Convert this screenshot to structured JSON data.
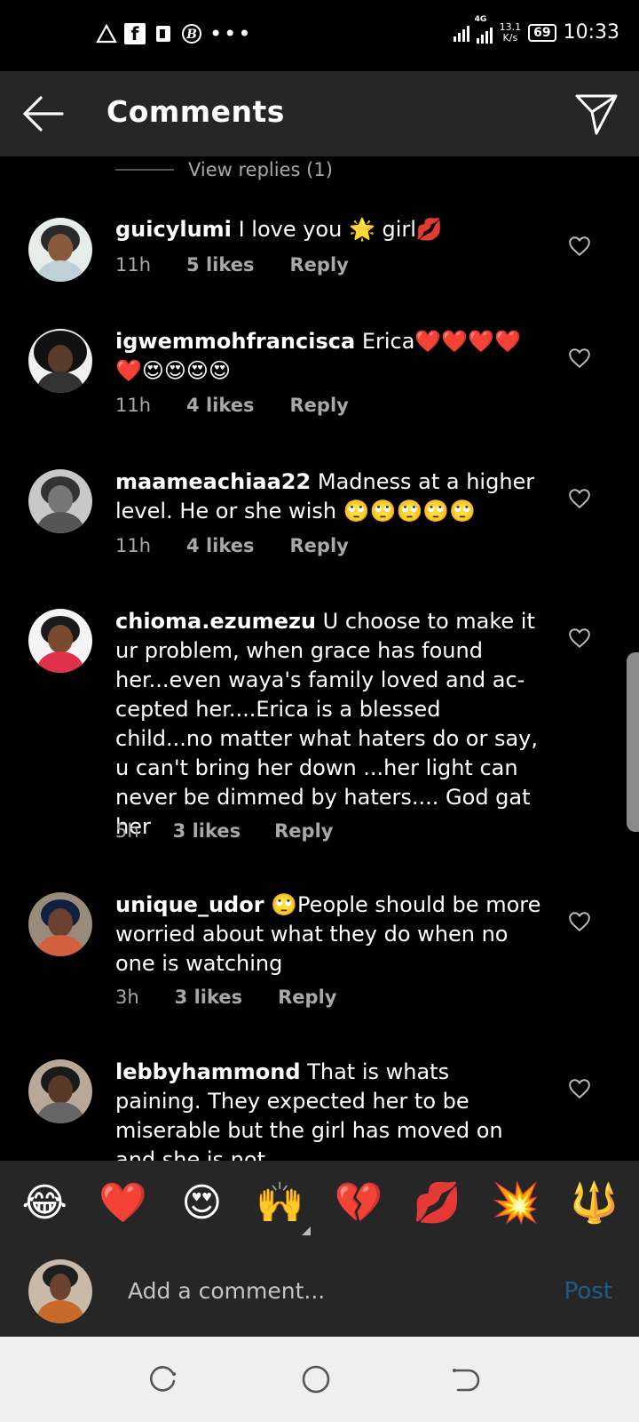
{
  "status_bar": {
    "network": "4G",
    "speed_value": "13.1",
    "speed_unit": "K/s",
    "battery": "69",
    "time": "10:33",
    "notification_dots": "•••"
  },
  "header": {
    "title": "Comments"
  },
  "view_replies": "View replies (1)",
  "comments": [
    {
      "user": "guicylumi",
      "text": "I love you 🌟 girl💋",
      "time": "11h",
      "likes": "5 likes",
      "reply": "Reply"
    },
    {
      "user": "igwemmohfrancisca",
      "text": "Erica❤️❤️❤️❤️❤️😍😍😍😍",
      "time": "11h",
      "likes": "4 likes",
      "reply": "Reply"
    },
    {
      "user": "maameachiaa22",
      "text": "Madness at a higher level. He or she wish 🙄🙄🙄🙄🙄",
      "time": "11h",
      "likes": "4 likes",
      "reply": "Reply"
    },
    {
      "user": "chioma.ezumezu",
      "text": "U choose to make it ur problem, when grace has found her...even waya's family loved and ac- cepted her....Erica is a blessed child...no matter what haters do or say, u can't bring her down ...her light can never be dimmed by haters.... God gat her",
      "time": "5h",
      "likes": "3 likes",
      "reply": "Reply"
    },
    {
      "user": "unique_udor",
      "text": "🙄People should be more worried about what they do when no one is watching",
      "time": "3h",
      "likes": "3 likes",
      "reply": "Reply"
    },
    {
      "user": "lebbyhammond",
      "text": "That is whats paining. They expected her to be miserable but the girl has moved on and she is not",
      "time": "",
      "likes": "",
      "reply": ""
    }
  ],
  "emojis": [
    "😂",
    "❤️",
    "😍",
    "🙌",
    "💔",
    "💋",
    "💥",
    "🔱"
  ],
  "add_comment": {
    "placeholder": "Add a comment...",
    "post": "Post"
  },
  "colors": {
    "background": "#000000",
    "bar": "#262626",
    "meta_text": "#a8a8a8",
    "post_disabled": "#1d5d86",
    "navbar": "#efefef"
  }
}
